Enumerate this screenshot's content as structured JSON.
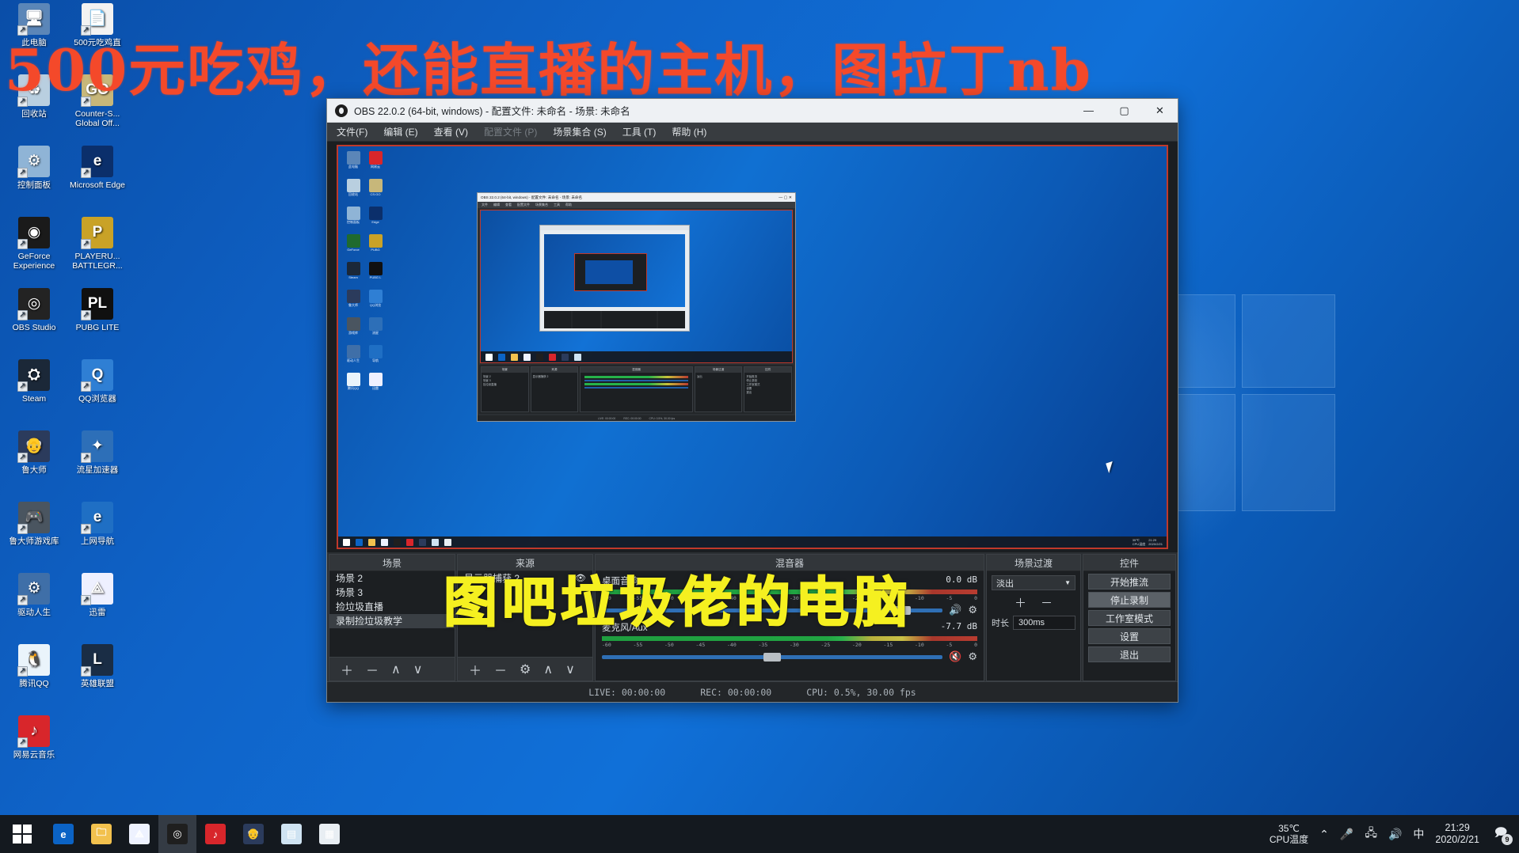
{
  "overlay": {
    "title_text": "500元吃鸡，还能直播的主机，图拉丁nb",
    "watermark_text": "图吧垃圾佬的电脑",
    "title_color": "#f4492a",
    "watermark_color": "#f5f020"
  },
  "desktop": {
    "icons": [
      {
        "label": "此电脑",
        "icon": "this-pc-icon",
        "color": "#5b86b8",
        "glyph": "🖥"
      },
      {
        "label": "回收站",
        "icon": "recycle-bin-icon",
        "color": "#b9cfe0",
        "glyph": "♻"
      },
      {
        "label": "控制面板",
        "icon": "control-panel-icon",
        "color": "#8fb4d6",
        "glyph": "⚙"
      },
      {
        "label": "GeForce Experience",
        "icon": "geforce-experience-icon",
        "color": "#1a1a1a",
        "glyph": "◉"
      },
      {
        "label": "OBS Studio",
        "icon": "obs-studio-icon",
        "color": "#232323",
        "glyph": "◎"
      },
      {
        "label": "Steam",
        "icon": "steam-icon",
        "color": "#1b2838",
        "glyph": "⛭"
      },
      {
        "label": "鲁大师",
        "icon": "ludashi-icon",
        "color": "#2b3b5c",
        "glyph": "👴"
      },
      {
        "label": "鲁大师游戏库",
        "icon": "ludashi-games-icon",
        "color": "#4a5560",
        "glyph": "🎮"
      },
      {
        "label": "驱动人生",
        "icon": "drivelife-icon",
        "color": "#3f6fa8",
        "glyph": "⚙"
      },
      {
        "label": "腾讯QQ",
        "icon": "tencent-qq-icon",
        "color": "#eaf4fb",
        "glyph": "🐧"
      },
      {
        "label": "网易云音乐",
        "icon": "netease-music-icon",
        "color": "#d8262b",
        "glyph": "♪"
      },
      {
        "label": "500元吃鸡直",
        "icon": "text-document-icon",
        "color": "#f2f2f2",
        "glyph": "📄"
      },
      {
        "label": "Counter-S... Global Off...",
        "icon": "csgo-icon",
        "color": "#c7b77a",
        "glyph": "GO"
      },
      {
        "label": "Microsoft Edge",
        "icon": "microsoft-edge-icon",
        "color": "#0b2f6b",
        "glyph": "e"
      },
      {
        "label": "PLAYERU... BATTLEGR...",
        "icon": "pubg-icon",
        "color": "#c9a227",
        "glyph": "P"
      },
      {
        "label": "PUBG LITE",
        "icon": "pubg-lite-icon",
        "color": "#101010",
        "glyph": "PL"
      },
      {
        "label": "QQ浏览器",
        "icon": "qq-browser-icon",
        "color": "#2f7fd4",
        "glyph": "Q"
      },
      {
        "label": "流星加速器",
        "icon": "meteor-accel-icon",
        "color": "#2d6fb8",
        "glyph": "✦"
      },
      {
        "label": "上网导航",
        "icon": "web-nav-icon",
        "color": "#1f6fc4",
        "glyph": "e"
      },
      {
        "label": "迅雷",
        "icon": "thunder-xunlei-icon",
        "color": "#eef0ff",
        "glyph": "⟁"
      },
      {
        "label": "英雄联盟",
        "icon": "league-of-legends-icon",
        "color": "#1a2d45",
        "glyph": "L"
      }
    ]
  },
  "obs": {
    "titlebar": {
      "title": "OBS 22.0.2 (64-bit, windows) - 配置文件: 未命名 - 场景: 未命名",
      "minimize": "—",
      "maximize": "▢",
      "close": "✕"
    },
    "menu": [
      {
        "label": "文件(F)",
        "dim": false
      },
      {
        "label": "编辑 (E)",
        "dim": false
      },
      {
        "label": "查看 (V)",
        "dim": false
      },
      {
        "label": "配置文件 (P)",
        "dim": true
      },
      {
        "label": "场景集合 (S)",
        "dim": false
      },
      {
        "label": "工具 (T)",
        "dim": false
      },
      {
        "label": "帮助 (H)",
        "dim": false
      }
    ],
    "scenes": {
      "title": "场景",
      "items": [
        {
          "label": "场景 2",
          "selected": false
        },
        {
          "label": "场景 3",
          "selected": false
        },
        {
          "label": "捡垃圾直播",
          "selected": false
        },
        {
          "label": "录制捡垃圾教学",
          "selected": true
        }
      ],
      "toolbar": [
        "＋",
        "－",
        "∧",
        "∨"
      ]
    },
    "sources": {
      "title": "来源",
      "items": [
        {
          "label": "显示器捕获 2",
          "visible_icon": "eye-icon"
        }
      ],
      "toolbar": [
        "＋",
        "－",
        "⚙",
        "∧",
        "∨"
      ]
    },
    "mixer": {
      "title": "混音器",
      "tracks": [
        {
          "name": "桌面音响",
          "db": "0.0 dB",
          "volume_percent": 88,
          "muted": false,
          "mute_icon": "speaker-icon"
        },
        {
          "name": "麦克风/Aux",
          "db": "-7.7 dB",
          "volume_percent": 50,
          "muted": true,
          "mute_icon": "speaker-muted-icon"
        }
      ],
      "ruler": [
        "-60",
        "-55",
        "-50",
        "-45",
        "-40",
        "-35",
        "-30",
        "-25",
        "-20",
        "-15",
        "-10",
        "-5",
        "0"
      ]
    },
    "transitions": {
      "title": "场景过渡",
      "selected": "淡出",
      "add_label": "＋",
      "remove_label": "－",
      "duration_label": "时长",
      "duration_value": "300ms"
    },
    "controls": {
      "title": "控件",
      "buttons": [
        {
          "label": "开始推流",
          "active": false
        },
        {
          "label": "停止录制",
          "active": true
        },
        {
          "label": "工作室模式",
          "active": false
        },
        {
          "label": "设置",
          "active": false
        },
        {
          "label": "退出",
          "active": false
        }
      ]
    },
    "status": {
      "live": "LIVE: 00:00:00",
      "rec": "REC: 00:00:00",
      "cpu": "CPU: 0.5%, 30.00 fps"
    },
    "nested": {
      "title": "OBS 22.0.2 (64-bit, windows) - 配置文件: 未命名 - 场景: 未命名",
      "menu": [
        "文件",
        "编辑",
        "查看",
        "配置文件",
        "场景集合",
        "工具",
        "帮助"
      ],
      "panels": [
        {
          "title": "场景",
          "rows": [
            "场景 2",
            "场景 3",
            "捡垃圾直播"
          ]
        },
        {
          "title": "来源",
          "rows": [
            "显示器捕获 2"
          ]
        },
        {
          "title": "混音器",
          "rows": []
        },
        {
          "title": "场景过渡",
          "rows": [
            "淡出"
          ]
        },
        {
          "title": "控件",
          "rows": [
            "开始推流",
            "停止录制",
            "工作室模式",
            "设置",
            "退出"
          ]
        }
      ],
      "status": [
        "LIVE: 00:00:00",
        "REC: 00:00:00",
        "CPU: 0.5%, 30.00 fps"
      ]
    }
  },
  "taskbar": {
    "start_icon": "windows-start-icon",
    "apps": [
      {
        "name": "edge-icon",
        "glyph": "e",
        "color": "#0b63c5",
        "active": false
      },
      {
        "name": "file-explorer-icon",
        "glyph": "🗀",
        "color": "#f2c14e",
        "active": false
      },
      {
        "name": "thunder-xunlei-icon",
        "glyph": "⟁",
        "color": "#eef2ff",
        "active": false
      },
      {
        "name": "obs-studio-icon",
        "glyph": "◎",
        "color": "#1f1f1f",
        "active": true
      },
      {
        "name": "netease-music-icon",
        "glyph": "♪",
        "color": "#d8262b",
        "active": false
      },
      {
        "name": "ludashi-icon",
        "glyph": "👴",
        "color": "#2b3b5c",
        "active": false
      },
      {
        "name": "window-icon",
        "glyph": "▤",
        "color": "#cfe3f2",
        "active": false
      },
      {
        "name": "calculator-icon",
        "glyph": "▦",
        "color": "#e8eef3",
        "active": false
      }
    ],
    "tray": {
      "cpu_temp_value": "35℃",
      "cpu_temp_label": "CPU温度",
      "chevron_icon": "chevron-up-icon",
      "mic_icon": "microphone-icon",
      "network_icon": "network-icon",
      "volume_icon": "volume-icon",
      "ime_label": "中",
      "time": "21:29",
      "date": "2020/2/21",
      "notification_icon": "notification-icon",
      "notification_count": "9"
    }
  }
}
